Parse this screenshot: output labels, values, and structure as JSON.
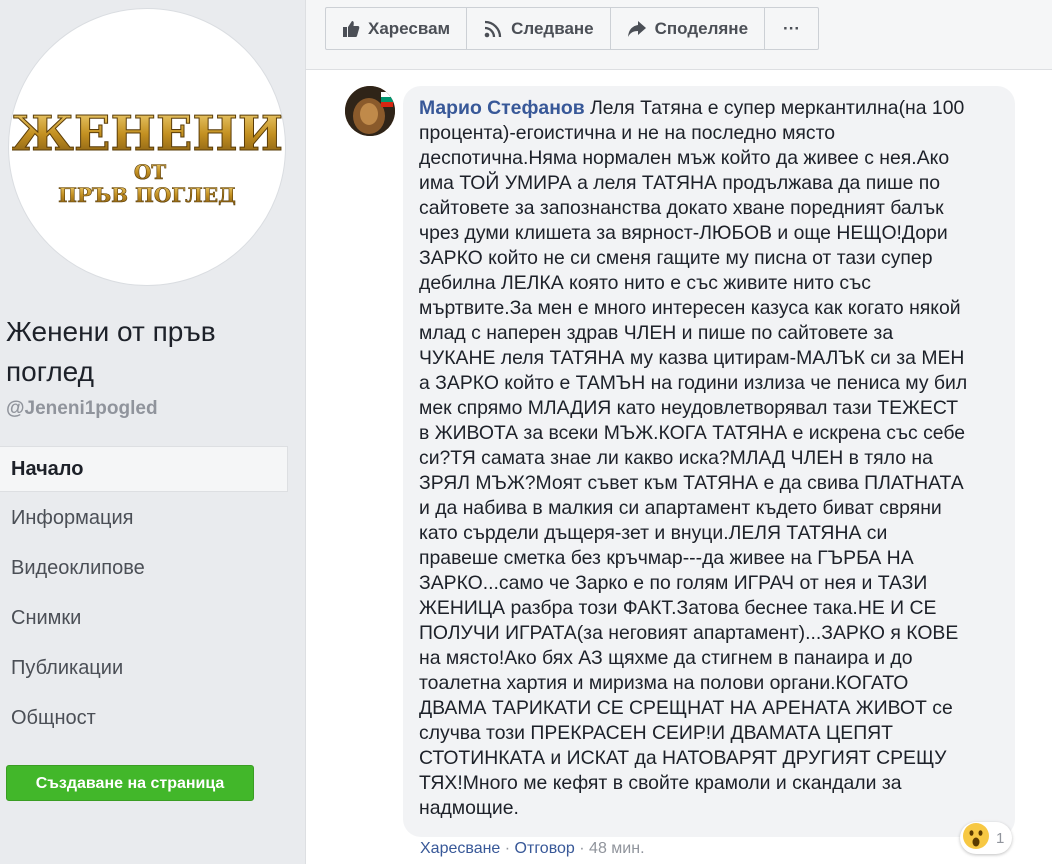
{
  "sidebar": {
    "logo_text": {
      "line1": "ЖЕНЕНИ",
      "line2": "ОТ",
      "line3": "ПРЪВ ПОГЛЕД"
    },
    "page_name": "Женени от пръв поглед",
    "handle": "@Jeneni1pogled",
    "nav": [
      {
        "label": "Начало",
        "active": true
      },
      {
        "label": "Информация"
      },
      {
        "label": "Видеоклипове"
      },
      {
        "label": "Снимки"
      },
      {
        "label": "Публикации"
      },
      {
        "label": "Общност"
      }
    ],
    "create_page_label": "Създаване на страница"
  },
  "toolbar": {
    "like_label": "Харесвам",
    "follow_label": "Следване",
    "share_label": "Споделяне",
    "more_label": "···"
  },
  "comment": {
    "author": "Марио Стефанов",
    "text": "Леля Татяна е супер меркантилна(на 100\nпроцента)-егоистична и не на последно място\nдеспотична.Няма нормален мъж който да живее с нея.Ако\nима ТОЙ УМИРА а леля ТАТЯНА продължава да пише по\nсайтовете за запознанства докато хване поредният балък\nчрез думи клишета за вярност-ЛЮБОВ и още НЕЩО!Дори\nЗАРКО който не си сменя гащите му писна от тази супер\nдебилна ЛЕЛКА която нито е със живите нито със\nмъртвите.За мен е много интересен казуса как когато някой\nмлад с наперен здрав ЧЛЕН и пише по сайтовете за\nЧУКАНЕ леля ТАТЯНА му казва цитирам-МАЛЪК си за МЕН\nа ЗАРКО който е ТАМЪН на години излиза че пениса му бил\nмек спрямо МЛАДИЯ като неудовлетворявал тази ТЕЖЕСТ\nв ЖИВОТА за всеки МЪЖ.КОГА ТАТЯНА е искрена със себе\nси?ТЯ самата знае ли какво иска?МЛАД ЧЛЕН в тяло на\nЗРЯЛ МЪЖ?Моят съвет към ТАТЯНА е да свива ПЛАТНАТА\nи да набива в малкия си апартамент където биват свряни\nкато сърдели дъщеря-зет и внуци.ЛЕЛЯ ТАТЯНА си\nправеше сметка без кръчмар---да живее на ГЪРБА НА\nЗАРКО...само че Зарко е по голям ИГРАЧ от нея и ТАЗИ\nЖЕНИЦА разбра този ФАКТ.Затова беснее така.НЕ И СЕ\nПОЛУЧИ ИГРАТА(за неговият апартамент)...ЗАРКО я КОВЕ\nна място!Ако бях АЗ щяхме да стигнем в панаира и до\nтоалетна хартия и миризма на полови органи.КОГАТО\nДВАМА ТАРИКАТИ СЕ СРЕЩНАТ НА АРЕНАТА ЖИВОТ се\nслучва този ПРЕКРАСЕН СЕИР!И ДВАМАТА ЦЕПЯТ\nСТОТИНКАТА и ИСКАТ да НАТОВАРЯТ ДРУГИЯТ СРЕЩУ\nТЯХ!Много ме кефят в свойте крамоли и скандали за\nнадмощие.",
    "reaction_count": "1",
    "actions": {
      "like": "Харесване",
      "sep": " · ",
      "reply": "Отговор",
      "time": "48 мин."
    }
  },
  "colors": {
    "link": "#385898",
    "create_button": "#42b72a",
    "logo_gold": "#c9a227"
  }
}
